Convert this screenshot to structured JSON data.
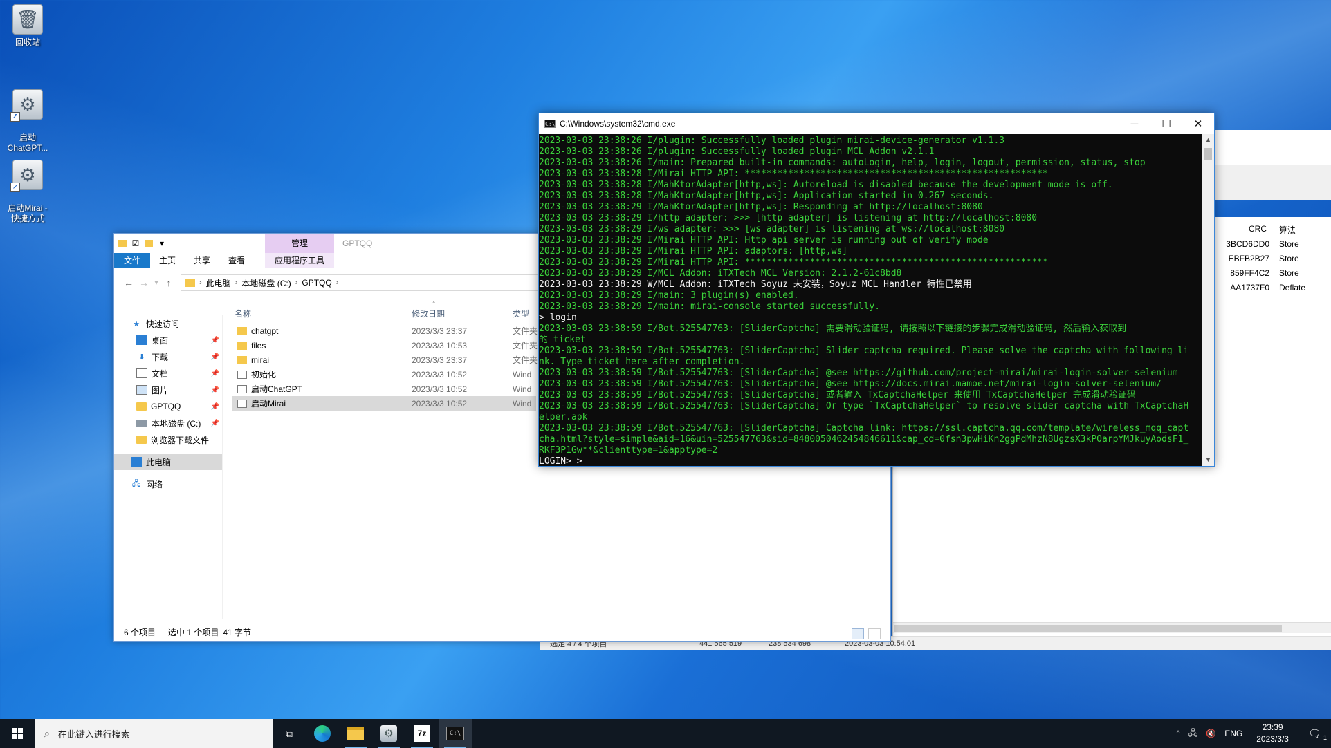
{
  "desktop": {
    "icons": [
      {
        "label": "回收站",
        "icon": "recycle-bin-icon"
      },
      {
        "label": "启动\nChatGPT...",
        "icon": "shortcut-icon"
      },
      {
        "label": "启动Mirai -\n快捷方式",
        "icon": "shortcut-icon"
      }
    ]
  },
  "explorer": {
    "window_label": "GPTQQ",
    "manage_tab": "管理",
    "ribbon_tabs": {
      "file": "文件",
      "home": "主页",
      "share": "共享",
      "view": "查看",
      "app_tools": "应用程序工具"
    },
    "breadcrumb": [
      "此电脑",
      "本地磁盘 (C:)",
      "GPTQQ"
    ],
    "nav": {
      "quick_access": "快速访问",
      "desktop": "桌面",
      "downloads": "下载",
      "documents": "文档",
      "pictures": "图片",
      "gptqq": "GPTQQ",
      "local_disk": "本地磁盘 (C:)",
      "browser_downloads": "浏览器下载文件",
      "this_pc": "此电脑",
      "network": "网络"
    },
    "columns": {
      "name": "名称",
      "date": "修改日期",
      "type": "类型"
    },
    "files": [
      {
        "name": "chatgpt",
        "date": "2023/3/3 23:37",
        "type": "文件夹"
      },
      {
        "name": "files",
        "date": "2023/3/3 10:53",
        "type": "文件夹"
      },
      {
        "name": "mirai",
        "date": "2023/3/3 23:37",
        "type": "文件夹"
      },
      {
        "name": "初始化",
        "date": "2023/3/3 10:52",
        "type": "Wind"
      },
      {
        "name": "启动ChatGPT",
        "date": "2023/3/3 10:52",
        "type": "Wind"
      },
      {
        "name": "启动Mirai",
        "date": "2023/3/3 10:52",
        "type": "Wind"
      }
    ],
    "status": {
      "count": "6 个项目",
      "selected": "选中 1 个项目",
      "size": "41 字节"
    }
  },
  "archive": {
    "headers": {
      "crc": "CRC",
      "method": "算法"
    },
    "rows": [
      {
        "crc": "3BCD6DD0",
        "method": "Store"
      },
      {
        "crc": "EBFB2B27",
        "method": "Store"
      },
      {
        "crc": "859FF4C2",
        "method": "Store"
      },
      {
        "crc": "AA1737F0",
        "method": "Deflate"
      }
    ],
    "status": {
      "selected": "选定 4 / 4 个项目",
      "size": "441 565 519",
      "packed": "238 534 698",
      "modified": "2023-03-03 10:54:01"
    }
  },
  "cmd": {
    "title": "C:\\Windows\\system32\\cmd.exe",
    "lines": [
      {
        "text": "2023-03-03 23:38:26 I/plugin: Successfully loaded plugin mirai-device-generator v1.1.3",
        "style": "green"
      },
      {
        "text": "2023-03-03 23:38:26 I/plugin: Successfully loaded plugin MCL Addon v2.1.1",
        "style": "green"
      },
      {
        "text": "2023-03-03 23:38:26 I/main: Prepared built-in commands: autoLogin, help, login, logout, permission, status, stop",
        "style": "green"
      },
      {
        "text": "2023-03-03 23:38:28 I/Mirai HTTP API: ********************************************************",
        "style": "green"
      },
      {
        "text": "2023-03-03 23:38:28 I/MahKtorAdapter[http,ws]: Autoreload is disabled because the development mode is off.",
        "style": "green"
      },
      {
        "text": "2023-03-03 23:38:28 I/MahKtorAdapter[http,ws]: Application started in 0.267 seconds.",
        "style": "green"
      },
      {
        "text": "2023-03-03 23:38:29 I/MahKtorAdapter[http,ws]: Responding at http://localhost:8080",
        "style": "green"
      },
      {
        "text": "2023-03-03 23:38:29 I/http adapter: >>> [http adapter] is listening at http://localhost:8080",
        "style": "green"
      },
      {
        "text": "2023-03-03 23:38:29 I/ws adapter: >>> [ws adapter] is listening at ws://localhost:8080",
        "style": "green"
      },
      {
        "text": "2023-03-03 23:38:29 I/Mirai HTTP API: Http api server is running out of verify mode",
        "style": "green"
      },
      {
        "text": "2023-03-03 23:38:29 I/Mirai HTTP API: adaptors: [http,ws]",
        "style": "green"
      },
      {
        "text": "2023-03-03 23:38:29 I/Mirai HTTP API: ********************************************************",
        "style": "green"
      },
      {
        "text": "2023-03-03 23:38:29 I/MCL Addon: iTXTech MCL Version: 2.1.2-61c8bd8",
        "style": "green"
      },
      {
        "text": "2023-03-03 23:38:29 W/MCL Addon: iTXTech Soyuz 未安装，Soyuz MCL Handler 特性已禁用",
        "style": "white"
      },
      {
        "text": "2023-03-03 23:38:29 I/main: 3 plugin(s) enabled.",
        "style": "green"
      },
      {
        "text": "2023-03-03 23:38:29 I/main: mirai-console started successfully.",
        "style": "green"
      },
      {
        "text": "> login",
        "style": "white"
      },
      {
        "text": "2023-03-03 23:38:59 I/Bot.525547763: [SliderCaptcha] 需要滑动验证码, 请按照以下链接的步骤完成滑动验证码, 然后输入获取到",
        "style": "green"
      },
      {
        "text": "的 ticket",
        "style": "green"
      },
      {
        "text": "2023-03-03 23:38:59 I/Bot.525547763: [SliderCaptcha] Slider captcha required. Please solve the captcha with following li",
        "style": "green"
      },
      {
        "text": "nk. Type ticket here after completion.",
        "style": "green"
      },
      {
        "text": "2023-03-03 23:38:59 I/Bot.525547763: [SliderCaptcha] @see https://github.com/project-mirai/mirai-login-solver-selenium",
        "style": "green"
      },
      {
        "text": "2023-03-03 23:38:59 I/Bot.525547763: [SliderCaptcha] @see https://docs.mirai.mamoe.net/mirai-login-solver-selenium/",
        "style": "green"
      },
      {
        "text": "2023-03-03 23:38:59 I/Bot.525547763: [SliderCaptcha] 或者输入 TxCaptchaHelper 来使用 TxCaptchaHelper 完成滑动验证码",
        "style": "green"
      },
      {
        "text": "2023-03-03 23:38:59 I/Bot.525547763: [SliderCaptcha] Or type `TxCaptchaHelper` to resolve slider captcha with TxCaptchaH",
        "style": "green"
      },
      {
        "text": "elper.apk",
        "style": "green"
      },
      {
        "text": "2023-03-03 23:38:59 I/Bot.525547763: [SliderCaptcha] Captcha link: https://ssl.captcha.qq.com/template/wireless_mqq_capt",
        "style": "green"
      },
      {
        "text": "cha.html?style=simple&aid=16&uin=525547763&sid=8480050462454846611&cap_cd=0fsn3pwHiKn2ggPdMhzN8UgzsX3kPOarpYMJkuyAodsF1_",
        "style": "green"
      },
      {
        "text": "RKF3P1Gw**&clienttype=1&apptype=2",
        "style": "green"
      },
      {
        "text": "LOGIN> >",
        "style": "input"
      }
    ]
  },
  "taskbar": {
    "search_placeholder": "在此键入进行搜索",
    "lang": "ENG",
    "time": "23:39",
    "date": "2023/3/3",
    "notification_count": "1"
  }
}
